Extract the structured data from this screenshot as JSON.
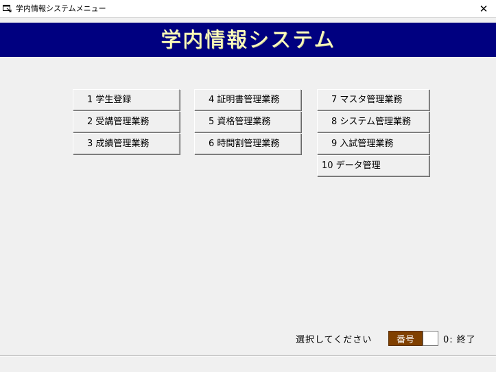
{
  "window": {
    "title": "学内情報システムメニュー",
    "close_label": "✕"
  },
  "banner": {
    "title": "学内情報システム",
    "bg_color": "#000080",
    "text_color": "#ffffc0"
  },
  "menu": {
    "items": [
      {
        "label": "1 学生登録"
      },
      {
        "label": "2 受講管理業務"
      },
      {
        "label": "3 成績管理業務"
      },
      {
        "label": "4 証明書管理業務"
      },
      {
        "label": "5 資格管理業務"
      },
      {
        "label": "6 時間割管理業務"
      },
      {
        "label": "7 マスタ管理業務"
      },
      {
        "label": "8 システム管理業務"
      },
      {
        "label": "9 入試管理業務"
      },
      {
        "label": "10 データ管理"
      }
    ]
  },
  "footer": {
    "prompt": "選択してください",
    "field_label": "番号",
    "field_value": "",
    "end_hint": "0: 終了",
    "label_color": "#804000"
  },
  "icons": {
    "app": "app-window-icon",
    "close": "close-icon"
  }
}
